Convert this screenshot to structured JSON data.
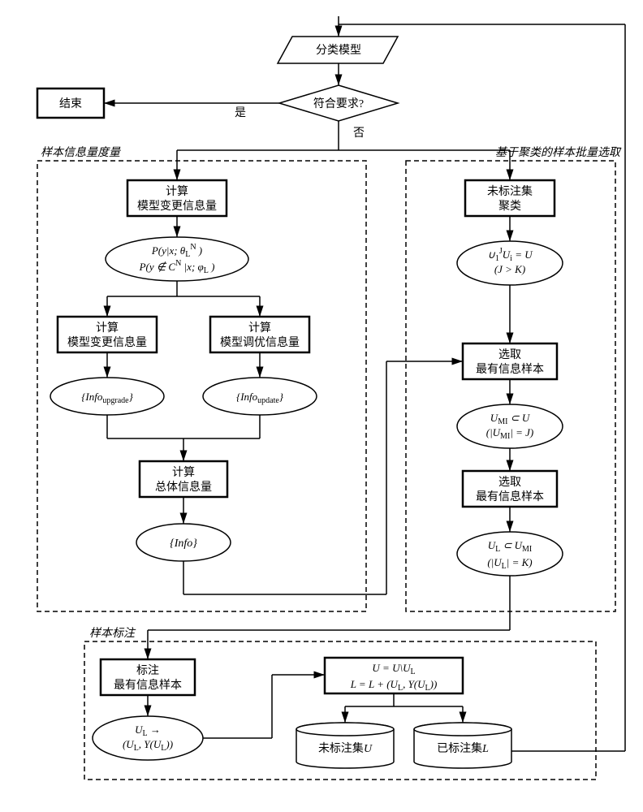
{
  "top": {
    "model": "分类模型",
    "decision": "符合要求?",
    "yes": "是",
    "no": "否",
    "end": "结束"
  },
  "left_section": {
    "title": "样本信息量度量",
    "calc_model_change": "计算\n模型变更信息量",
    "prob1": "P(y|x; θ_L^N)",
    "prob2": "P(y ∉ C^N | x; φ_L)",
    "calc_change": "计算\n模型变更信息量",
    "calc_tune": "计算\n模型调优信息量",
    "info_upgrade": "{Info_upgrade}",
    "info_update": "{Info_update}",
    "calc_total": "计算\n总体信息量",
    "info": "{Info}"
  },
  "right_section": {
    "title": "基于聚类的样本批量选取",
    "cluster": "未标注集\n聚类",
    "cluster_result": "∪_1^J U_i = U\n(J > K)",
    "select1": "选取\n最有信息样本",
    "select1_result": "U_MI ⊂ U\n(|U_MI| = J)",
    "select2": "选取\n最有信息样本",
    "select2_result": "U_L ⊂ U_MI\n(|U_L| = K)"
  },
  "bottom_section": {
    "title": "样本标注",
    "annotate": "标注\n最有信息样本",
    "annotate_result": "U_L → (U_L, Y(U_L))",
    "update_sets": "U = U\\U_L\nL = L + (U_L, Y(U_L))",
    "unlabeled": "未标注集U",
    "labeled": "已标注集L"
  }
}
